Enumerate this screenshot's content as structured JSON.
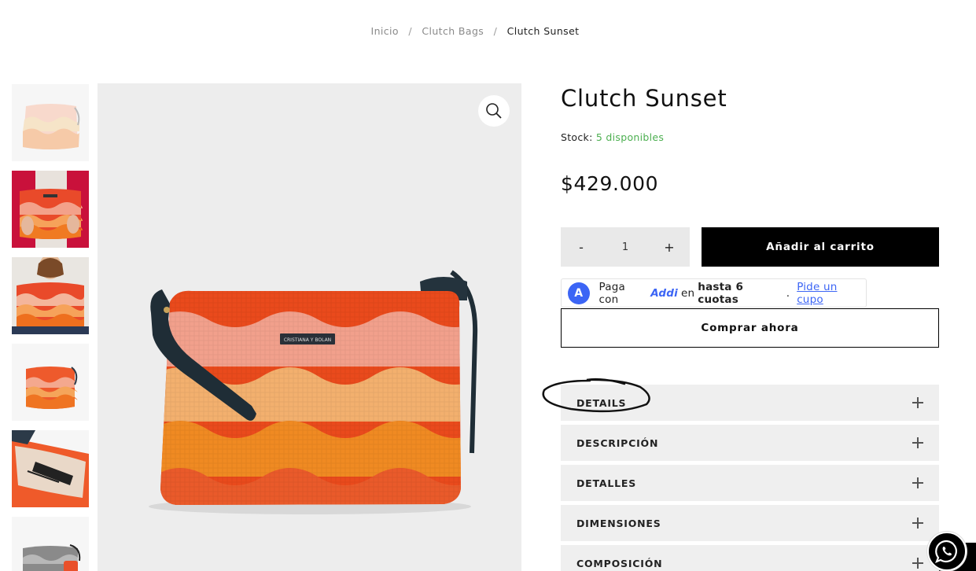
{
  "breadcrumb": {
    "items": [
      "Inicio",
      "Clutch Bags",
      "Clutch Sunset"
    ],
    "separator": "/"
  },
  "gallery": {
    "thumbnails": [
      "thumb-1",
      "thumb-2",
      "thumb-3",
      "thumb-4",
      "thumb-5",
      "thumb-6"
    ],
    "zoom_icon": "magnifier-icon"
  },
  "product": {
    "title": "Clutch Sunset",
    "stock_label": "Stock:",
    "stock_value": "5 disponibles",
    "price": "$429.000",
    "quantity": {
      "minus": "-",
      "value": "1",
      "plus": "+"
    },
    "add_to_cart": "Añadir al carrito",
    "buy_now": "Comprar ahora"
  },
  "addi": {
    "prefix": "Paga con",
    "brand": "Addi",
    "middle": "en",
    "bold": "hasta 6 cuotas",
    "suffix": ".",
    "link": "Pide un cupo",
    "logo_letter": "A"
  },
  "accordions": [
    {
      "label": "DETAILS"
    },
    {
      "label": "DESCRIPCIÓN"
    },
    {
      "label": "DETALLES"
    },
    {
      "label": "DIMENSIONES"
    },
    {
      "label": "COMPOSICIÓN"
    }
  ],
  "colors": {
    "accent_blue": "#3c65f5",
    "stock_green": "#4caf50",
    "button_black": "#000000",
    "accordion_bg": "#efefef"
  },
  "floating": {
    "whatsapp_icon": "whatsapp-icon"
  }
}
